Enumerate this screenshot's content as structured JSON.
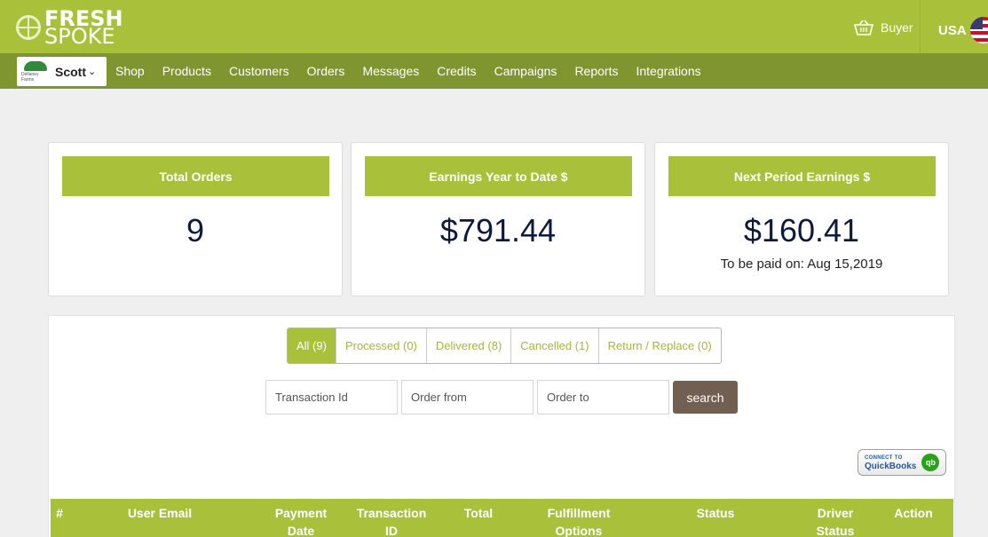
{
  "header": {
    "logo_line1": "FRESH",
    "logo_line2": "SPOKE",
    "buyer_label": "Buyer",
    "region_label": "USA"
  },
  "nav": {
    "account_name": "Scott",
    "account_logo_text": "Dellaney Farms",
    "items": [
      {
        "label": "Shop"
      },
      {
        "label": "Products"
      },
      {
        "label": "Customers"
      },
      {
        "label": "Orders"
      },
      {
        "label": "Messages"
      },
      {
        "label": "Credits"
      },
      {
        "label": "Campaigns"
      },
      {
        "label": "Reports"
      },
      {
        "label": "Integrations"
      }
    ]
  },
  "stats": [
    {
      "title": "Total Orders",
      "value": "9",
      "subtext": ""
    },
    {
      "title": "Earnings Year to Date $",
      "value": "$791.44",
      "subtext": ""
    },
    {
      "title": "Next Period Earnings $",
      "value": "$160.41",
      "subtext": "To be paid on: Aug 15,2019"
    }
  ],
  "filters": [
    {
      "label": "All (9)",
      "active": true
    },
    {
      "label": "Processed (0)",
      "active": false
    },
    {
      "label": "Delivered (8)",
      "active": false
    },
    {
      "label": "Cancelled (1)",
      "active": false
    },
    {
      "label": "Return / Replace (0)",
      "active": false
    }
  ],
  "search": {
    "transaction_placeholder": "Transaction Id",
    "from_placeholder": "Order from",
    "to_placeholder": "Order to",
    "button_label": "search"
  },
  "quickbooks": {
    "line1": "CONNECT TO",
    "line2": "QuickBooks",
    "icon_text": "qb"
  },
  "table": {
    "columns": [
      {
        "line1": "",
        "line2": "#"
      },
      {
        "line1": "",
        "line2": "User Email"
      },
      {
        "line1": "Payment",
        "line2": "Date"
      },
      {
        "line1": "Transaction",
        "line2": "ID"
      },
      {
        "line1": "",
        "line2": "Total"
      },
      {
        "line1": "Fulfillment",
        "line2": "Options"
      },
      {
        "line1": "",
        "line2": "Status"
      },
      {
        "line1": "Driver",
        "line2": "Status"
      },
      {
        "line1": "",
        "line2": "Action"
      }
    ]
  },
  "colors": {
    "brand_green": "#a9c03a",
    "nav_green": "#7f9530",
    "search_brown": "#715f52",
    "value_navy": "#0e1a3c"
  }
}
